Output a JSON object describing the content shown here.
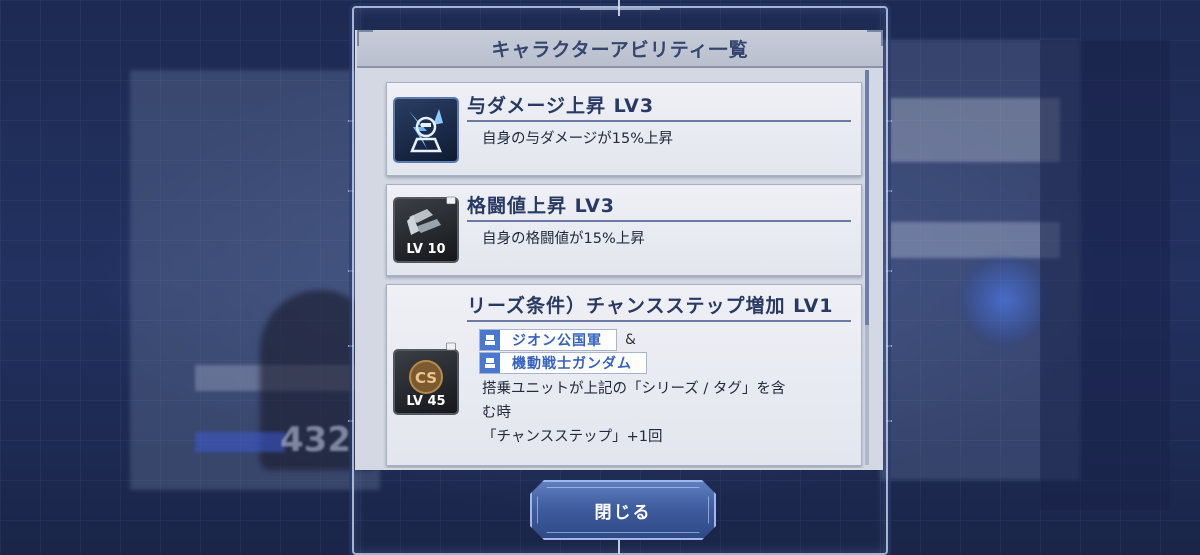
{
  "dialog": {
    "title": "キャラクターアビリティ一覧",
    "close_label": "閉じる"
  },
  "abilities": [
    {
      "title": "与ダメージ上昇 LV3",
      "description": "自身の与ダメージが15%上昇",
      "locked": false,
      "icon": "damage-up-icon"
    },
    {
      "title": "格闘値上昇 LV3",
      "description": "自身の格闘値が15%上昇",
      "locked": true,
      "unlock_level": "LV 10",
      "icon": "melee-up-icon"
    },
    {
      "title": "リーズ条件）チャンスステップ増加 LV1",
      "locked": true,
      "unlock_level": "LV 45",
      "icon_badge": "CS",
      "tags": [
        "ジオン公国軍",
        "機動戦士ガンダム"
      ],
      "tag_joiner": "&",
      "condition_line1": "搭乗ユニットが上記の「シリーズ / タグ」を含",
      "condition_line2": "む時",
      "condition_line3": "「チャンスステップ」+1回"
    }
  ],
  "background": {
    "score_text": "432"
  },
  "colors": {
    "accent": "#3561c2",
    "title_text": "#283a63",
    "header_bg": "#c7ccd8",
    "button_bg": "#3d5a9b"
  }
}
